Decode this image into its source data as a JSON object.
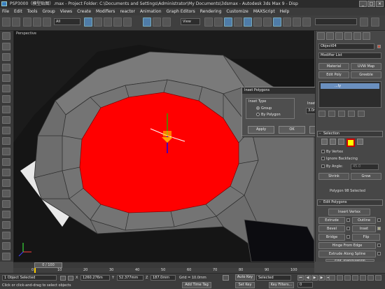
{
  "title": "PSP3000（模型贴图）.max    - Project Folder: C:\\Documents and Settings\\Administrator\\My Documents\\3dsmax    - Autodesk 3ds Max 9    - Disp",
  "window_buttons": [
    "_",
    "□",
    "×"
  ],
  "menu": [
    "File",
    "Edit",
    "Tools",
    "Group",
    "Views",
    "Create",
    "Modifiers",
    "reactor",
    "Animation",
    "Graph Editors",
    "Rendering",
    "Customize",
    "MAXScript",
    "Help"
  ],
  "toolbar": {
    "selection_filter": "All",
    "coord_system": "View",
    "coord_caption": "Vtx",
    "selection_set": ""
  },
  "viewport": {
    "label": "Perspective"
  },
  "panel": {
    "object_name": "Object04",
    "modifier_list": "Modifier List",
    "buttons": {
      "material": "Material",
      "uvw_map": "UVW Map",
      "edit_poly": "Edit Poly",
      "greeble": "Greeble",
      "modifier_stack_item": "...ly"
    },
    "selection_rollout": "Selection",
    "by_vertex": "By Vertex",
    "ignore_backfacing": "Ignore Backfacing",
    "by_angle": "By Angle:",
    "by_angle_value": "45.0",
    "shrink": "Shrink",
    "grow": "Grow",
    "selected_status": "Polygon 98 Selected",
    "edit_polygons_rollout": "Edit Polygons",
    "insert_vertex": "Insert Vertex",
    "extrude": "Extrude",
    "outline": "Outline",
    "bevel": "Bevel",
    "inset": "Inset",
    "bridge": "Bridge",
    "flip": "Flip",
    "hinge_from_edge": "Hinge From Edge",
    "extrude_along_spline": "Extrude Along Spline",
    "edit_triangulation": "Edit Triangulation"
  },
  "dialog": {
    "title": "Inset Polygons",
    "inset_type_label": "Inset Type",
    "option_group": "Group",
    "option_by_polygon": "By Polygon",
    "selected_option": "Group",
    "inset_amount_label": "Inset Amount",
    "inset_amount_value": "3.0mm",
    "apply": "Apply",
    "ok": "OK",
    "cancel": "Cancel"
  },
  "timeline": {
    "frame": "0 / 100",
    "ticks": [
      "0",
      "10",
      "20",
      "30",
      "40",
      "50",
      "60",
      "70",
      "80",
      "90",
      "100"
    ]
  },
  "status": {
    "selection": "1 Object Selected",
    "prompt": "Click or click-and-drag to select objects",
    "x_label": "X",
    "x_value": "1260.276m",
    "y_label": "Y",
    "y_value": "52.377mm",
    "z_label": "Z",
    "z_value": "187.0mm",
    "grid": "Grid = 10.0mm",
    "add_time_tag": "Add Time Tag",
    "auto_key": "Auto Key",
    "auto_key_mode": "Selected",
    "set_key": "Set Key",
    "key_filters": "Key Filters...",
    "frame_field": "0"
  },
  "colors": {
    "selected_face": "#ff0000",
    "mesh": "#6a6a6a",
    "swatch": "#ffff00"
  }
}
